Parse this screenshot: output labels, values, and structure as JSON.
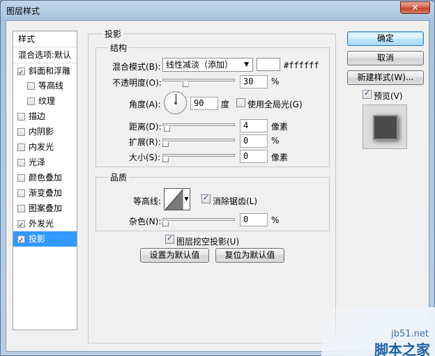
{
  "window": {
    "title": "图层样式",
    "close": "✕"
  },
  "style_list": {
    "header": "样式",
    "blend_default": "混合选项:默认",
    "items": [
      {
        "label": "斜面和浮雕",
        "checked": true
      },
      {
        "label": "等高线",
        "checked": false
      },
      {
        "label": "纹理",
        "checked": false
      },
      {
        "label": "描边",
        "checked": false
      },
      {
        "label": "内阴影",
        "checked": false
      },
      {
        "label": "内发光",
        "checked": false
      },
      {
        "label": "光泽",
        "checked": false
      },
      {
        "label": "颜色叠加",
        "checked": false
      },
      {
        "label": "渐变叠加",
        "checked": false
      },
      {
        "label": "图案叠加",
        "checked": false
      },
      {
        "label": "外发光",
        "checked": true
      },
      {
        "label": "投影",
        "checked": true,
        "selected": true
      }
    ]
  },
  "drop_shadow": {
    "title": "投影",
    "structure": {
      "title": "结构",
      "blend_mode_label": "混合模式(B):",
      "blend_mode_value": "线性减淡（添加）",
      "color_hex": "#ffffff",
      "opacity_label": "不透明度(O):",
      "opacity_value": "30",
      "opacity_unit": "%",
      "opacity_level": 0.3,
      "angle_label": "角度(A):",
      "angle_value": "90",
      "angle_unit": "度",
      "global_light_label": "使用全局光(G)",
      "global_light_checked": false,
      "distance_label": "距离(D):",
      "distance_value": "4",
      "distance_unit": "像素",
      "distance_level": 0.02,
      "spread_label": "扩展(R):",
      "spread_value": "0",
      "spread_unit": "%",
      "spread_level": 0,
      "size_label": "大小(S):",
      "size_value": "0",
      "size_unit": "像素",
      "size_level": 0
    },
    "quality": {
      "title": "品质",
      "contour_label": "等高线:",
      "antialias_label": "消除锯齿(L)",
      "antialias_checked": true,
      "noise_label": "杂色(N):",
      "noise_value": "0",
      "noise_unit": "%",
      "noise_level": 0
    },
    "knockout_label": "图层挖空投影(U)",
    "knockout_checked": true,
    "make_default_label": "设置为默认值",
    "reset_default_label": "复位为默认值"
  },
  "buttons": {
    "ok": "确定",
    "cancel": "取消",
    "new_style": "新建样式(W)...",
    "preview_label": "预览(V)",
    "preview_checked": true
  },
  "watermark": {
    "url": "jb51.net",
    "brand": "脚本之家"
  },
  "colors": {
    "selection": "#3399ff",
    "default_button": "#3c7fb1",
    "accent_check": "#1b3d7a"
  }
}
